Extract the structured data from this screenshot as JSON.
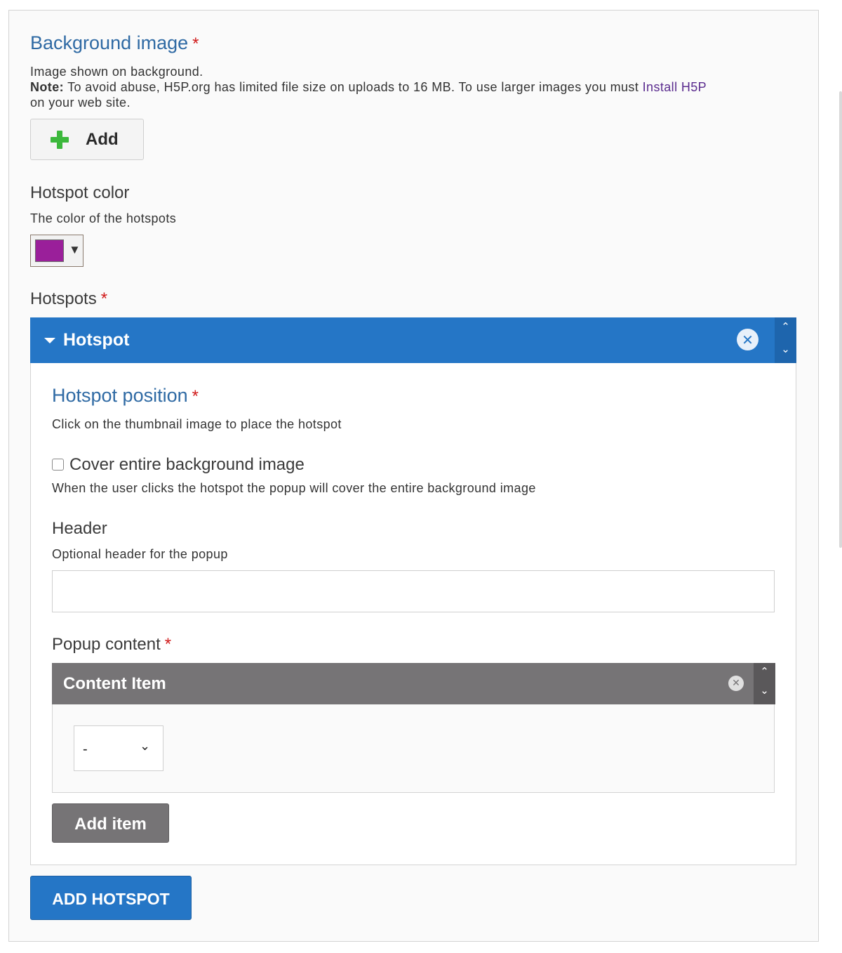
{
  "background_image": {
    "title": "Background image",
    "required_mark": "*",
    "description": "Image shown on background.",
    "note_label": "Note:",
    "note_text": " To avoid abuse, H5P.org has limited file size on uploads to 16 MB. To use larger images you must ",
    "note_link": "Install H5P",
    "note_tail": "on your web site.",
    "add_label": "Add"
  },
  "hotspot_color": {
    "title": "Hotspot color",
    "description": "The color of the hotspots",
    "value": "#9a1f9a"
  },
  "hotspots": {
    "title": "Hotspots",
    "required_mark": "*",
    "item_title": "Hotspot",
    "position": {
      "title": "Hotspot position",
      "required_mark": "*",
      "description": "Click on the thumbnail image to place the hotspot"
    },
    "cover": {
      "label": "Cover entire background image",
      "checked": false,
      "description": "When the user clicks the hotspot the popup will cover the entire background image"
    },
    "header": {
      "title": "Header",
      "description": "Optional header for the popup",
      "value": ""
    },
    "popup_content": {
      "title": "Popup content",
      "required_mark": "*",
      "item_title": "Content Item",
      "select_value": "-",
      "add_item_label": "Add item"
    },
    "add_hotspot_label": "ADD HOTSPOT"
  },
  "icons": {
    "add": "plus-icon",
    "remove": "close-circle-icon",
    "move_up": "chevron-up-icon",
    "move_down": "chevron-down-icon",
    "collapse": "caret-down-icon"
  },
  "colors": {
    "accent_blue": "#2576c6",
    "title_blue": "#2f6aa4",
    "required_red": "#d01a1a",
    "content_gray": "#767476",
    "add_green": "#3cb83c"
  }
}
